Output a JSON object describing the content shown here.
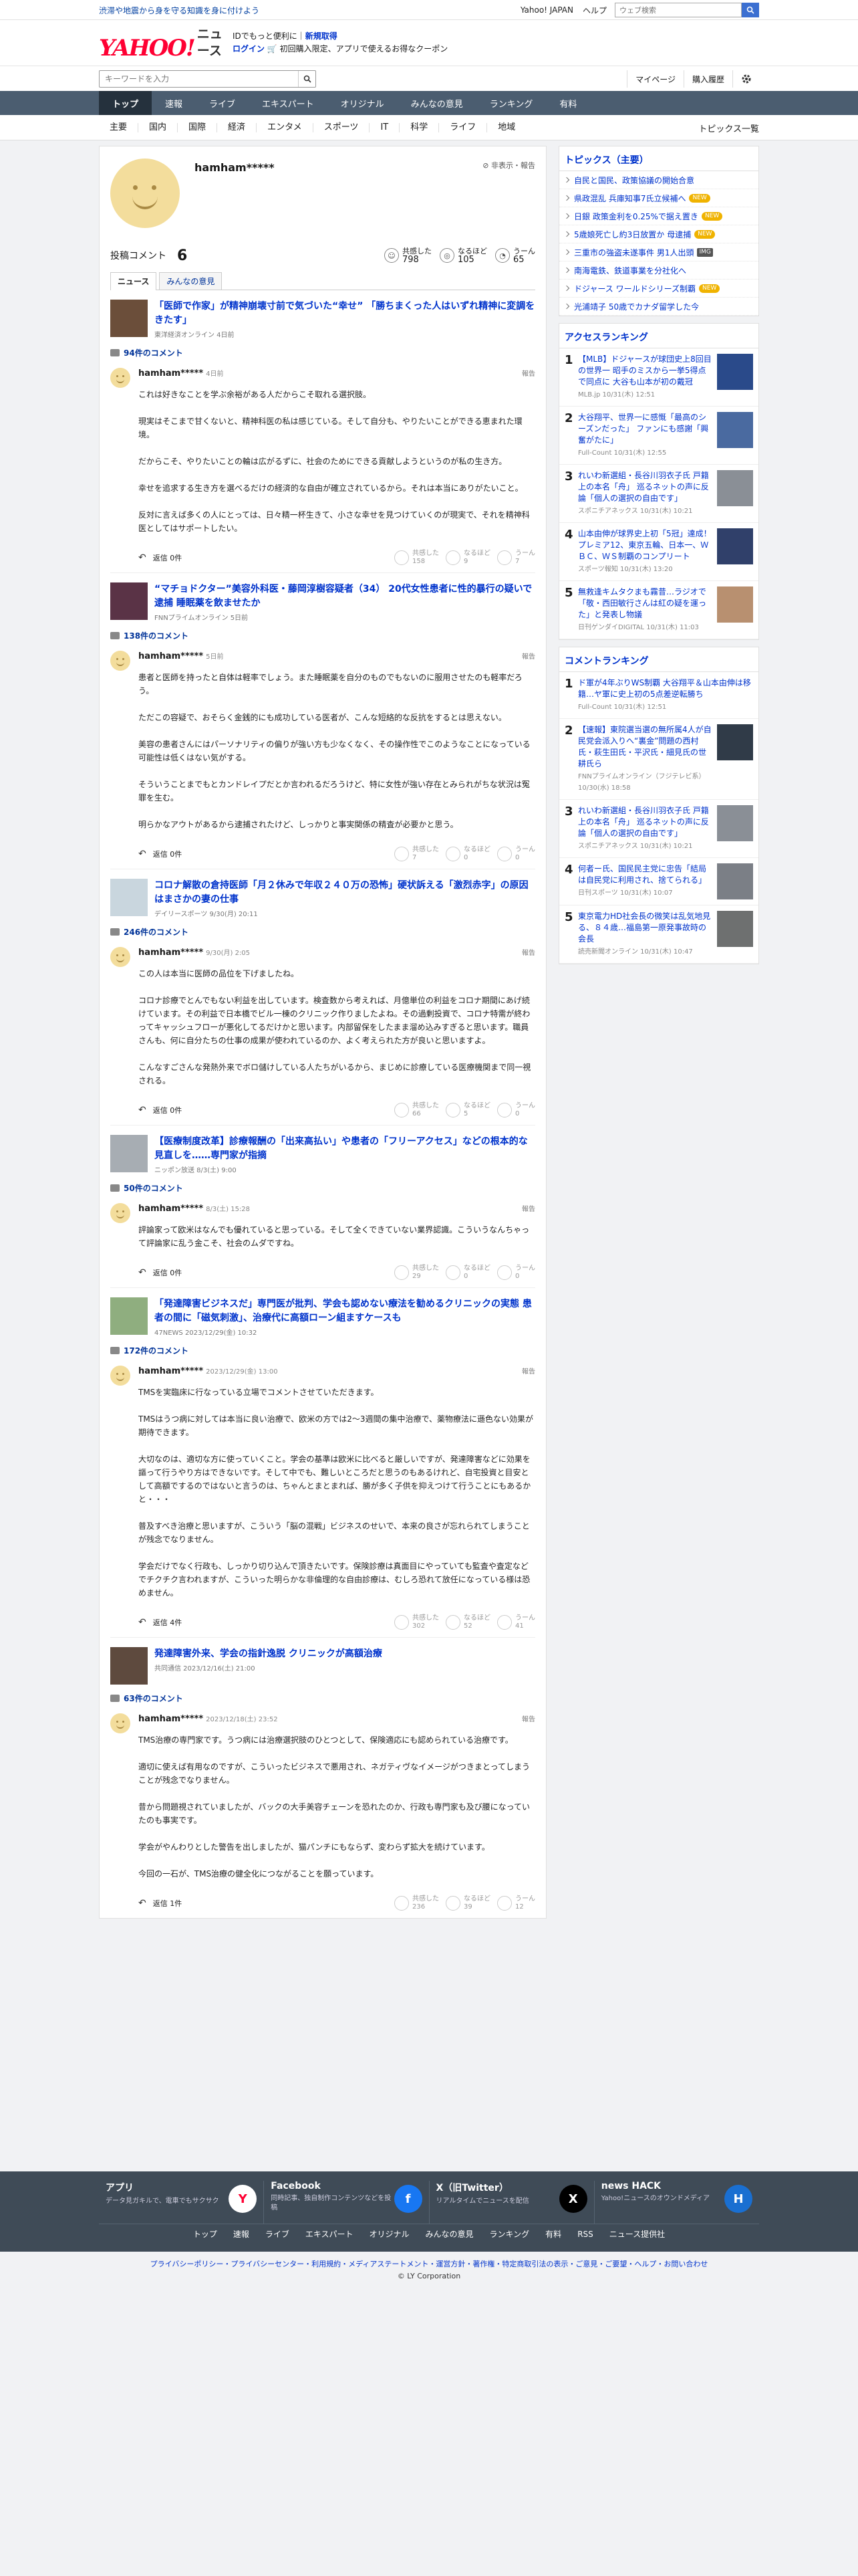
{
  "topbar": {
    "notice": "渋滞や地震から身を守る知識を身に付けよう",
    "links": [
      "Yahoo! JAPAN",
      "ヘルプ"
    ],
    "search_placeholder": "ウェブ検索"
  },
  "brand": {
    "logo": "YAHOO!",
    "logo_sub": "JAPAN",
    "service": "ニュース",
    "promo_line1_a": "IDでもっと便利に",
    "promo_line1_b": "新規取得",
    "promo_line2_a": "ログイン",
    "promo_line2_b": "初回購入限定、アプリで使えるお得なクーポン"
  },
  "toolbar": {
    "keyword_placeholder": "キーワードを入力",
    "mypage": "マイページ",
    "history": "購入履歴"
  },
  "mainnav": [
    "トップ",
    "速報",
    "ライブ",
    "エキスパート",
    "オリジナル",
    "みんなの意見",
    "ランキング",
    "有料"
  ],
  "subnav": [
    "主要",
    "国内",
    "国際",
    "経済",
    "エンタメ",
    "スポーツ",
    "IT",
    "科学",
    "ライフ",
    "地域"
  ],
  "subnav_right": "トピックス一覧",
  "profile": {
    "name": "hamham*****",
    "note": "非表示・報告",
    "comment_label": "投稿コメント",
    "comment_count": "6",
    "stats": [
      {
        "label": "共感した",
        "value": "798"
      },
      {
        "label": "なるほど",
        "value": "105"
      },
      {
        "label": "うーん",
        "value": "65"
      }
    ],
    "tabs": [
      "ニュース",
      "みんなの意見"
    ]
  },
  "articles": [
    {
      "title": "「医師で作家」が精神崩壊寸前で気づいた“幸せ” 「勝ちまくった人はいずれ精神に変調をきたす」",
      "source": "東洋経済オンライン 4日前",
      "count": "94件のコメント",
      "user": "hamham*****",
      "date": "4日前",
      "report": "報告",
      "paragraphs": [
        "これは好きなことを学ぶ余裕がある人だからこそ取れる選択肢。",
        "現実はそこまで甘くないと、精神科医の私は感じている。そして自分も、やりたいことができる恵まれた環境。",
        "だからこそ、やりたいことの輪は広がるずに、社会のためにできる貢献しようというのが私の生き方。",
        "幸せを追求する生き方を選べるだけの経済的な自由が確立されているから。それは本当にありがたいこと。",
        "反対に言えば多くの人にとっては、日々精一杯生きて、小さな幸せを見つけていくのが現実で、それを精神科医としてはサポートしたい。"
      ],
      "reply": "返信 0件",
      "r1": "158",
      "r2": "9",
      "r3": "7"
    },
    {
      "title": "“マチョドクター”美容外科医・藤岡淳樹容疑者（34） 20代女性患者に性的暴行の疑いで逮捕 睡眠薬を飲ませたか",
      "source": "FNNプライムオンライン 5日前",
      "count": "138件のコメント",
      "user": "hamham*****",
      "date": "5日前",
      "report": "報告",
      "paragraphs": [
        "患者と医師を持ったと自体は軽率でしょう。また睡眠薬を自分のものでもないのに服用させたのも軽率だろう。",
        "ただこの容疑で、おそらく金銭的にも成功している医者が、こんな短絡的な反抗をするとは思えない。",
        "美容の患者さんにはパーソナリティの偏りが強い方も少なくなく、その操作性でこのようなことになっている可能性は低くはない気がする。",
        "そういうことまでもとカンドレイプだとか言われるだろうけど、特に女性が強い存在とみられがちな状況は冤罪を生む。",
        "明らかなアウトがあるから逮捕されたけど、しっかりと事実関係の精査が必要かと思う。"
      ],
      "reply": "返信 0件",
      "r1": "7",
      "r2": "0",
      "r3": "0"
    },
    {
      "title": "コロナ解散の倉持医師「月２休みで年収２４０万の恐怖」硬状訴える「激烈赤字」の原因はまさかの妻の仕事",
      "source": "デイリースポーツ 9/30(月) 20:11",
      "count": "246件のコメント",
      "user": "hamham*****",
      "date": "9/30(月) 2:05",
      "report": "報告",
      "paragraphs": [
        "この人は本当に医師の品位を下げましたね。",
        "コロナ診療でとんでもない利益を出しています。検査数から考えれば、月億単位の利益をコロナ期間にあげ続けています。その利益で日本橋でビル一棟のクリニック作りましたよね。その過剰投資で、コロナ特需が終わってキャッシュフローが悪化してるだけかと思います。内部留保をしたまま溜め込みすぎると思います。職員さんも、何に自分たちの仕事の成果が使われているのか、よく考えられた方が良いと思いますよ。",
        "こんなすごさんな発熱外来でボロ儲けしている人たちがいるから、まじめに診療している医療機関まで同一視される。"
      ],
      "reply": "返信 0件",
      "r1": "66",
      "r2": "5",
      "r3": "0"
    },
    {
      "title": "【医療制度改革】診療報酬の「出来高払い」や患者の「フリーアクセス」などの根本的な見直しを……専門家が指摘",
      "source": "ニッポン放送 8/3(土) 9:00",
      "count": "50件のコメント",
      "user": "hamham*****",
      "date": "8/3(土) 15:28",
      "report": "報告",
      "paragraphs": [
        "評論家って欧米はなんでも優れていると思っている。そして全くできていない業界認識。こういうなんちゃって評論家に乱う金こそ、社会のムダですね。"
      ],
      "reply": "返信 0件",
      "r1": "29",
      "r2": "0",
      "r3": "0"
    },
    {
      "title": "「発達障害ビジネスだ」専門医が批判、学会も認めない療法を勧めるクリニックの実態 患者の間に「磁気刺激」、治療代に高額ローン組ますケースも",
      "source": "47NEWS 2023/12/29(金) 10:32",
      "count": "172件のコメント",
      "user": "hamham*****",
      "date": "2023/12/29(金) 13:00",
      "report": "報告",
      "paragraphs": [
        "TMSを実臨床に行なっている立場でコメントさせていただきます。",
        "TMSはうつ病に対しては本当に良い治療で、欧米の方では2〜3週間の集中治療で、薬物療法に遜色ない効果が期待できます。",
        "大切なのは、適切な方に使っていくこと。学会の基準は欧米に比べると厳しいですが、発達障害などに効果を謳って行うやり方はできないです。そして中でも、難しいところだと思うのもあるけれど、自宅投資と目安として高額でするのではないと言うのは、ちゃんとまとまれば、勝が多く子供を抑えつけて行うことにもあるかと・・・",
        "普及すべき治療と思いますが、こういう「脳の混戦」ビジネスのせいで、本来の良さが忘れられてしまうことが残念でなりません。",
        "学会だけでなく行政も、しっかり切り込んで頂きたいです。保険診療は真面目にやっていても監査や査定などでチクチク言われますが、こういった明らかな非倫理的な自由診療は、むしろ恐れて放任になっている様は恐めません。"
      ],
      "reply": "返信 4件",
      "r1": "302",
      "r2": "52",
      "r3": "41"
    },
    {
      "title": "発達障害外来、学会の指針逸脱 クリニックが高額治療",
      "source": "共同通信 2023/12/16(土) 21:00",
      "count": "63件のコメント",
      "user": "hamham*****",
      "date": "2023/12/18(土) 23:52",
      "report": "報告",
      "paragraphs": [
        "TMS治療の専門家です。うつ病には治療選択肢のひとつとして、保険適応にも認められている治療です。",
        "適切に使えば有用なのですが、こういったビジネスで悪用され、ネガティヴなイメージがつきまとってしまうことが残念でなりません。",
        "昔から問題視されていましたが、バックの大手美容チェーンを恐れたのか、行政も専門家も及び腰になっていたのも事実です。",
        "学会がやんわりとした警告を出しましたが、猫パンチにもならず、変わらず拡大を続けています。",
        "今回の一石が、TMS治療の健全化につながることを願っています。"
      ],
      "reply": "返信 1件",
      "r1": "236",
      "r2": "39",
      "r3": "12"
    }
  ],
  "reaction_labels": [
    "共感した",
    "なるほど",
    "うーん"
  ],
  "topics": {
    "heading": "トピックス（主要）",
    "items": [
      {
        "text": "自民と国民、政策協議の開始合意",
        "badge": ""
      },
      {
        "text": "県政混乱 兵庫知事7氏立候補へ",
        "badge": "NEW"
      },
      {
        "text": "日銀 政策金利を0.25%で据え置き",
        "badge": "NEW"
      },
      {
        "text": "5歳娘死亡し約3日放置か 母逮捕",
        "badge": "NEW"
      },
      {
        "text": "三重市の強盗未遂事件 男1人出頭",
        "badge": "IMG"
      },
      {
        "text": "南海電鉄、鉄道事業を分社化へ",
        "badge": ""
      },
      {
        "text": "ドジャース ワールドシリーズ制覇",
        "badge": "NEW"
      },
      {
        "text": "光浦靖子 50歳でカナダ留学した今",
        "badge": ""
      }
    ]
  },
  "access_ranking": {
    "heading": "アクセスランキング",
    "items": [
      {
        "rank": "1",
        "text": "【MLB】ドジャースが球団史上8回目の世界一 昭手のミスから一挙5得点で同点に 大谷も山本が初の戴冠",
        "meta": "MLB.jp 10/31(木) 12:51",
        "color": "#2a4a8a"
      },
      {
        "rank": "2",
        "text": "大谷翔平、世界一に感慨「最高のシーズンだった」 ファンにも感謝「興奮がたに」",
        "meta": "Full-Count 10/31(木) 12:55",
        "color": "#4a6aa0"
      },
      {
        "rank": "3",
        "text": "れいわ新選組・長谷川羽衣子氏 戸籍上の本名「舟」 巡るネットの声に反論「個人の選択の自由です」",
        "meta": "スポニチアネックス 10/31(木) 10:21",
        "color": "#8a8f96"
      },
      {
        "rank": "4",
        "text": "山本由伸が球界史上初「5冠」達成！プレミア12、東京五輪、日本一、ＷＢＣ、ＷＳ制覇のコンプリート",
        "meta": "スポーツ報知 10/31(木) 13:20",
        "color": "#30406a"
      },
      {
        "rank": "5",
        "text": "無救逢キムタクまも霧昔…ラジオで「敬・西田敏行さんは紅の疑を運った」と発表し物議",
        "meta": "日刊ゲンダイDIGITAL 10/31(木) 11:03",
        "color": "#b89070"
      }
    ]
  },
  "comment_ranking": {
    "heading": "コメントランキング",
    "items": [
      {
        "rank": "1",
        "text": "ド軍が4年ぶりWS制覇 大谷翔平＆山本由伸は移籍…ヤ軍に史上初の5点差逆転勝ち",
        "meta": "Full-Count 10/31(木) 12:51",
        "color": ""
      },
      {
        "rank": "2",
        "text": "【速報】東院選当選の無所属4人が自民党会派入りへ“裏金”問題の西村氏・萩生田氏・平沢氏・細見氏の世耕氏ら",
        "meta": "FNNプライムオンライン（フジテレビ系） 10/30(水) 18:58",
        "color": "#303b48"
      },
      {
        "rank": "3",
        "text": "れいわ新選組・長谷川羽衣子氏 戸籍上の本名「舟」 巡るネットの声に反論「個人の選択の自由です」",
        "meta": "スポニチアネックス 10/31(木) 10:21",
        "color": "#8a8f96"
      },
      {
        "rank": "4",
        "text": "何者ー氏、国民民主党に忠告「結局は自民党に利用され、捨てられる」",
        "meta": "日刊スポーツ 10/31(木) 10:07",
        "color": "#7b7f86"
      },
      {
        "rank": "5",
        "text": "東京電力HD社会長の微笑は乱気地見る、８４歳…福島第一原発事故時の会長",
        "meta": "読売新聞オンライン 10/31(木) 10:47",
        "color": "#6e7070"
      }
    ]
  },
  "footer": {
    "cells": [
      {
        "title": "アプリ",
        "desc": "データ見ガキルで、電車でもサクサク",
        "icon": "Y"
      },
      {
        "title": "Facebook",
        "desc": "同時記事、独自制作コンテンツなどを投稿",
        "icon": "f"
      },
      {
        "title": "X（旧Twitter）",
        "desc": "リアルタイムでニュースを配信",
        "icon": "X"
      },
      {
        "title": "news HACK",
        "desc": "Yahoo!ニュースのオウンドメディア",
        "icon": "H"
      }
    ],
    "nav": [
      "トップ",
      "速報",
      "ライブ",
      "エキスパート",
      "オリジナル",
      "みんなの意見",
      "ランキング",
      "有料",
      "RSS",
      "ニュース提供社"
    ]
  },
  "legal": {
    "links": "プライバシーポリシー・プライバシーセンター・利用規約・メディアステートメント・運営方針・著作権・特定商取引法の表示・ご意見・ご要望・ヘルプ・お問い合わせ",
    "copyright": "© LY Corporation"
  },
  "colors": {
    "accent": "#0033cc",
    "nav": "#4b5d70",
    "footer": "#3f4b57",
    "logo": "#ff0033"
  }
}
